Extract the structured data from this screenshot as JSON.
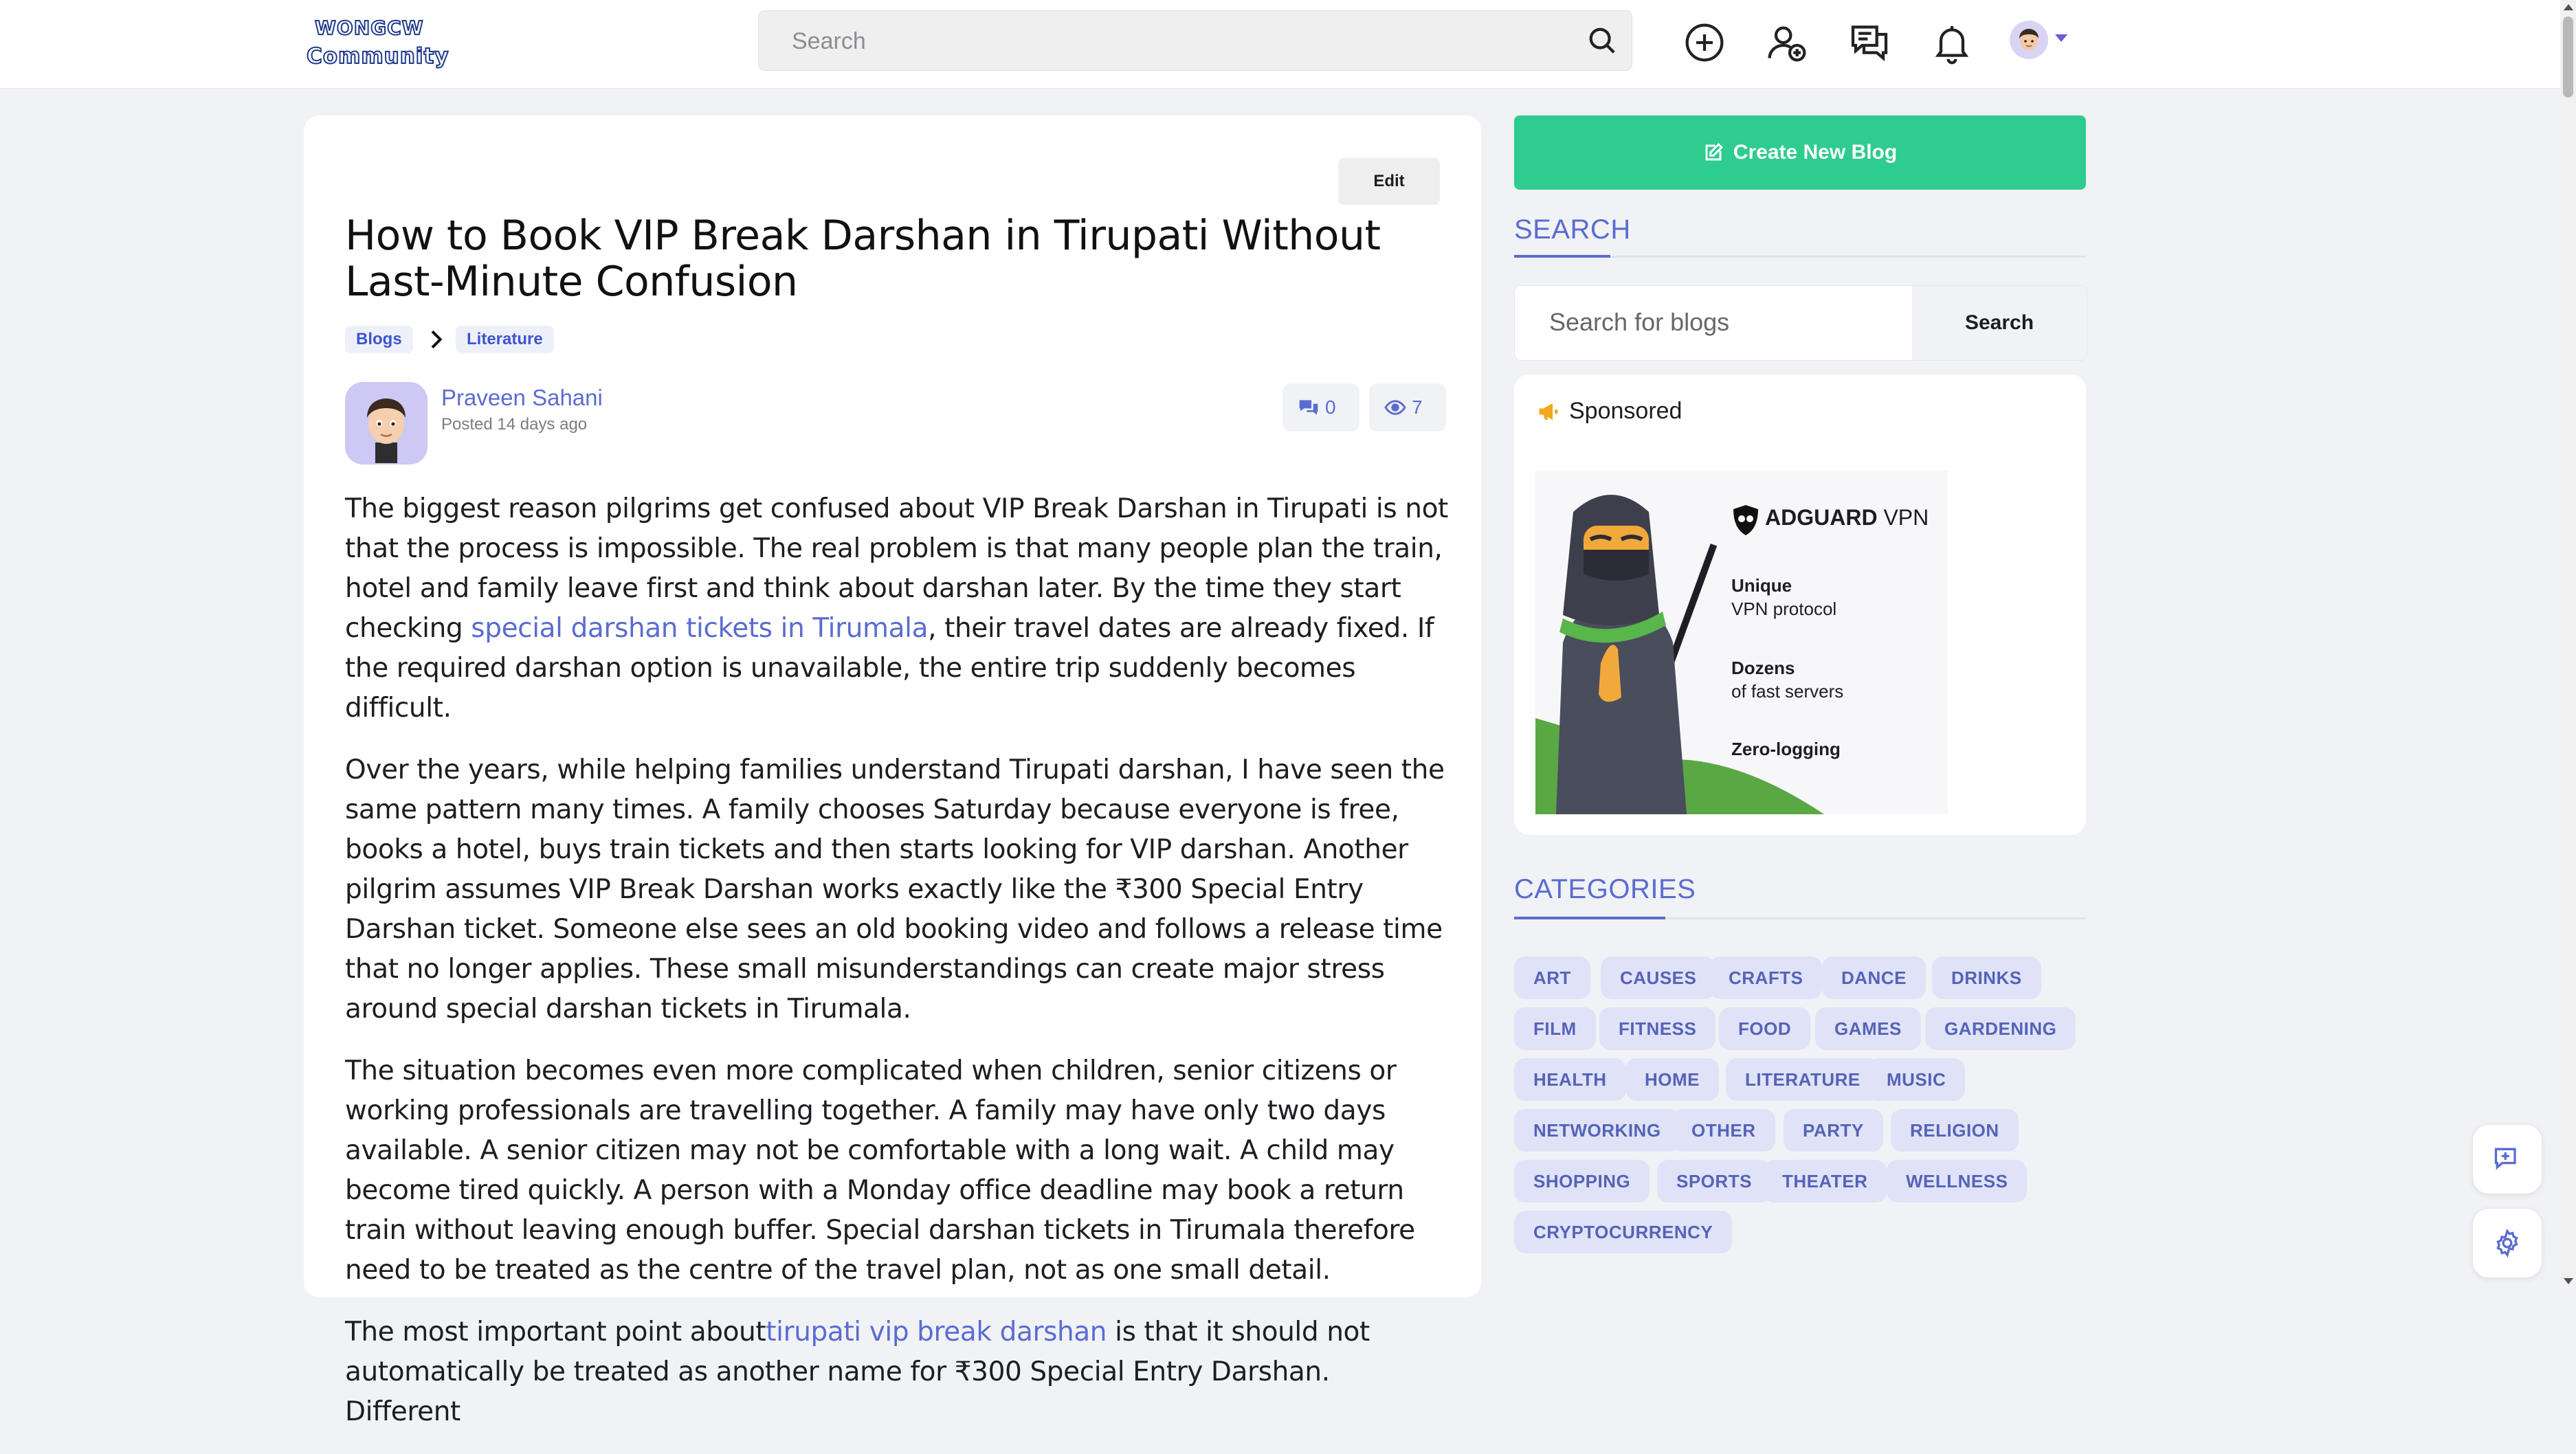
{
  "header": {
    "logo_line1": "WONGCW",
    "logo_line2": "Community",
    "search_placeholder": "Search"
  },
  "post": {
    "edit_label": "Edit",
    "title": "How to Book VIP Break Darshan in Tirupati Without Last-Minute Confusion",
    "breadcrumb": [
      "Blogs",
      "Literature"
    ],
    "author": "Praveen Sahani",
    "posted": "Posted 14 days ago",
    "comments": "0",
    "views": "7",
    "paragraphs": {
      "p1_a": "The biggest reason pilgrims get confused about VIP Break Darshan in Tirupati is not that the process is impossible. The real problem is that many people plan the train, hotel and family leave first and think about darshan later. By the time they start checking ",
      "p1_link": "special darshan tickets in Tirumala",
      "p1_b": ", their travel dates are already fixed. If the required darshan option is unavailable, the entire trip suddenly becomes difficult.",
      "p2": "Over the years, while helping families understand Tirupati darshan, I have seen the same pattern many times. A family chooses Saturday because everyone is free, books a hotel, buys train tickets and then starts looking for VIP darshan. Another pilgrim assumes VIP Break Darshan works exactly like the ₹300 Special Entry Darshan ticket. Someone else sees an old booking video and follows a release time that no longer applies. These small misunderstandings can create major stress around special darshan tickets in Tirumala.",
      "p3": "The situation becomes even more complicated when children, senior citizens or working professionals are travelling together. A family may have only two days available. A senior citizen may not be comfortable with a long wait. A child may become tired quickly. A person with a Monday office deadline may book a return train without leaving enough buffer. Special darshan tickets in Tirumala therefore need to be treated as the centre of the travel plan, not as one small detail.",
      "p4_a": "The most important point about",
      "p4_link": "tirupati vip break darshan",
      "p4_b": " is that it should not automatically be treated as another name for ₹300 Special Entry Darshan. Different"
    }
  },
  "sidebar": {
    "create_label": "Create New Blog",
    "search_heading": "SEARCH",
    "search_placeholder": "Search for blogs",
    "search_button": "Search",
    "sponsored_label": "Sponsored",
    "ad": {
      "brand_bold": "ADGUARD",
      "brand_thin": "VPN",
      "l1_title": "Unique",
      "l1_sub": "VPN protocol",
      "l2_title": "Dozens",
      "l2_sub": "of fast servers",
      "l3_title": "Zero-logging"
    },
    "categories_heading": "CATEGORIES",
    "categories": [
      "ART",
      "CAUSES",
      "CRAFTS",
      "DANCE",
      "DRINKS",
      "FILM",
      "FITNESS",
      "FOOD",
      "GAMES",
      "GARDENING",
      "HEALTH",
      "HOME",
      "LITERATURE",
      "MUSIC",
      "NETWORKING",
      "OTHER",
      "PARTY",
      "RELIGION",
      "SHOPPING",
      "SPORTS",
      "THEATER",
      "WELLNESS",
      "CRYPTOCURRENCY"
    ]
  },
  "colors": {
    "accent": "#5b6cd0",
    "create_button": "#2ecc8f",
    "chip_bg": "#e0e3f7"
  },
  "icons": [
    "search-icon",
    "add-circle-icon",
    "add-user-icon",
    "messages-icon",
    "bell-icon",
    "comment-icon",
    "eye-icon",
    "edit-icon",
    "megaphone-icon",
    "chat-plus-icon",
    "gear-icon"
  ]
}
